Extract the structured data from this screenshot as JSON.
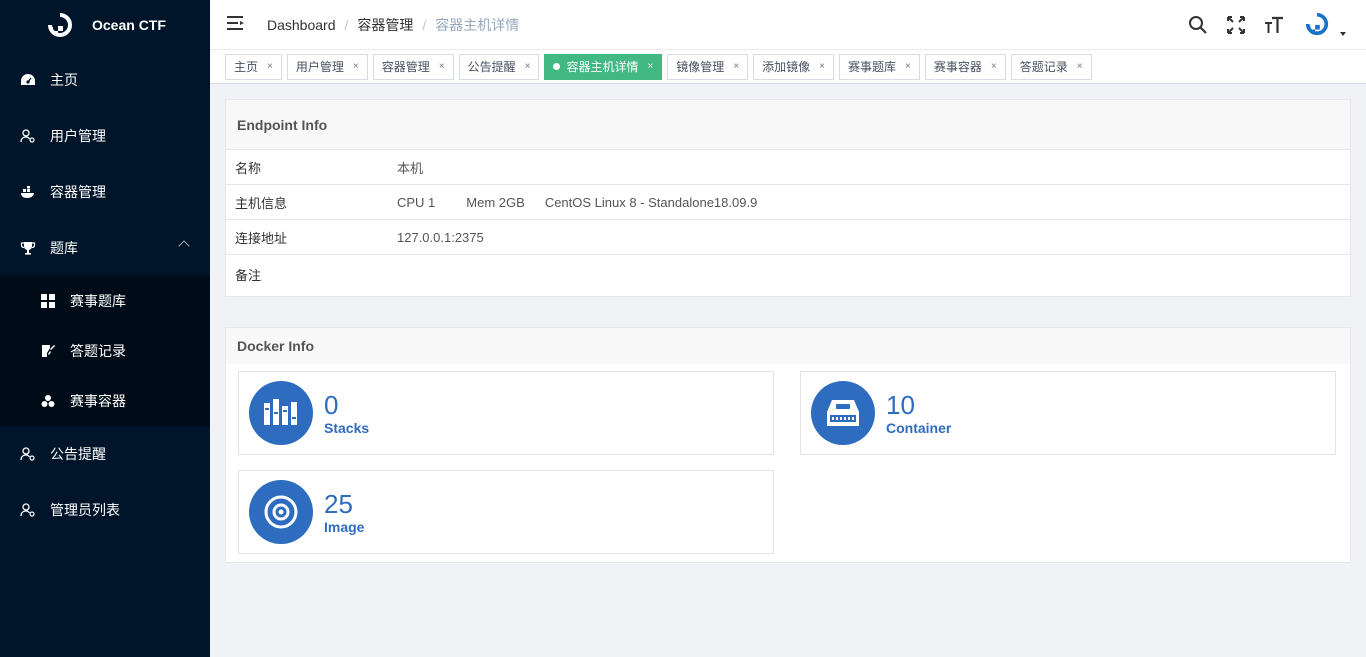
{
  "app": {
    "title": "Ocean CTF"
  },
  "sidebar": {
    "items": [
      {
        "label": "主页",
        "icon": "dashboard-icon"
      },
      {
        "label": "用户管理",
        "icon": "user-icon"
      },
      {
        "label": "容器管理",
        "icon": "container-icon"
      },
      {
        "label": "题库",
        "icon": "trophy-icon",
        "expanded": true
      },
      {
        "label": "公告提醒",
        "icon": "user-icon"
      },
      {
        "label": "管理员列表",
        "icon": "user-icon"
      }
    ],
    "subitems": [
      {
        "label": "赛事题库",
        "icon": "grid-icon"
      },
      {
        "label": "答题记录",
        "icon": "edit-icon"
      },
      {
        "label": "赛事容器",
        "icon": "cluster-icon"
      }
    ]
  },
  "header": {
    "breadcrumbs": [
      "Dashboard",
      "容器管理",
      "容器主机详情"
    ],
    "separator": "/"
  },
  "tags": [
    {
      "label": "主页",
      "active": false
    },
    {
      "label": "用户管理",
      "active": false
    },
    {
      "label": "容器管理",
      "active": false
    },
    {
      "label": "公告提醒",
      "active": false
    },
    {
      "label": "容器主机详情",
      "active": true
    },
    {
      "label": "镜像管理",
      "active": false
    },
    {
      "label": "添加镜像",
      "active": false
    },
    {
      "label": "赛事题库",
      "active": false
    },
    {
      "label": "赛事容器",
      "active": false
    },
    {
      "label": "答题记录",
      "active": false
    }
  ],
  "tag_close": "×",
  "endpoint": {
    "title": "Endpoint Info",
    "name_label": "名称",
    "name_value": "本机",
    "host_label": "主机信息",
    "host_cpu": "CPU 1",
    "host_mem": "Mem 2GB",
    "host_os": "CentOS Linux 8 - Standalone18.09.9",
    "addr_label": "连接地址",
    "addr_value": "127.0.0.1:2375",
    "note_label": "备注",
    "note_value": ""
  },
  "docker": {
    "title": "Docker Info",
    "stacks": {
      "count": "0",
      "label": "Stacks"
    },
    "container": {
      "count": "10",
      "label": "Container"
    },
    "image": {
      "count": "25",
      "label": "Image"
    }
  },
  "colors": {
    "sidebar_bg": "#001529",
    "accent": "#42b983",
    "card_blue": "#2e6cc0"
  }
}
